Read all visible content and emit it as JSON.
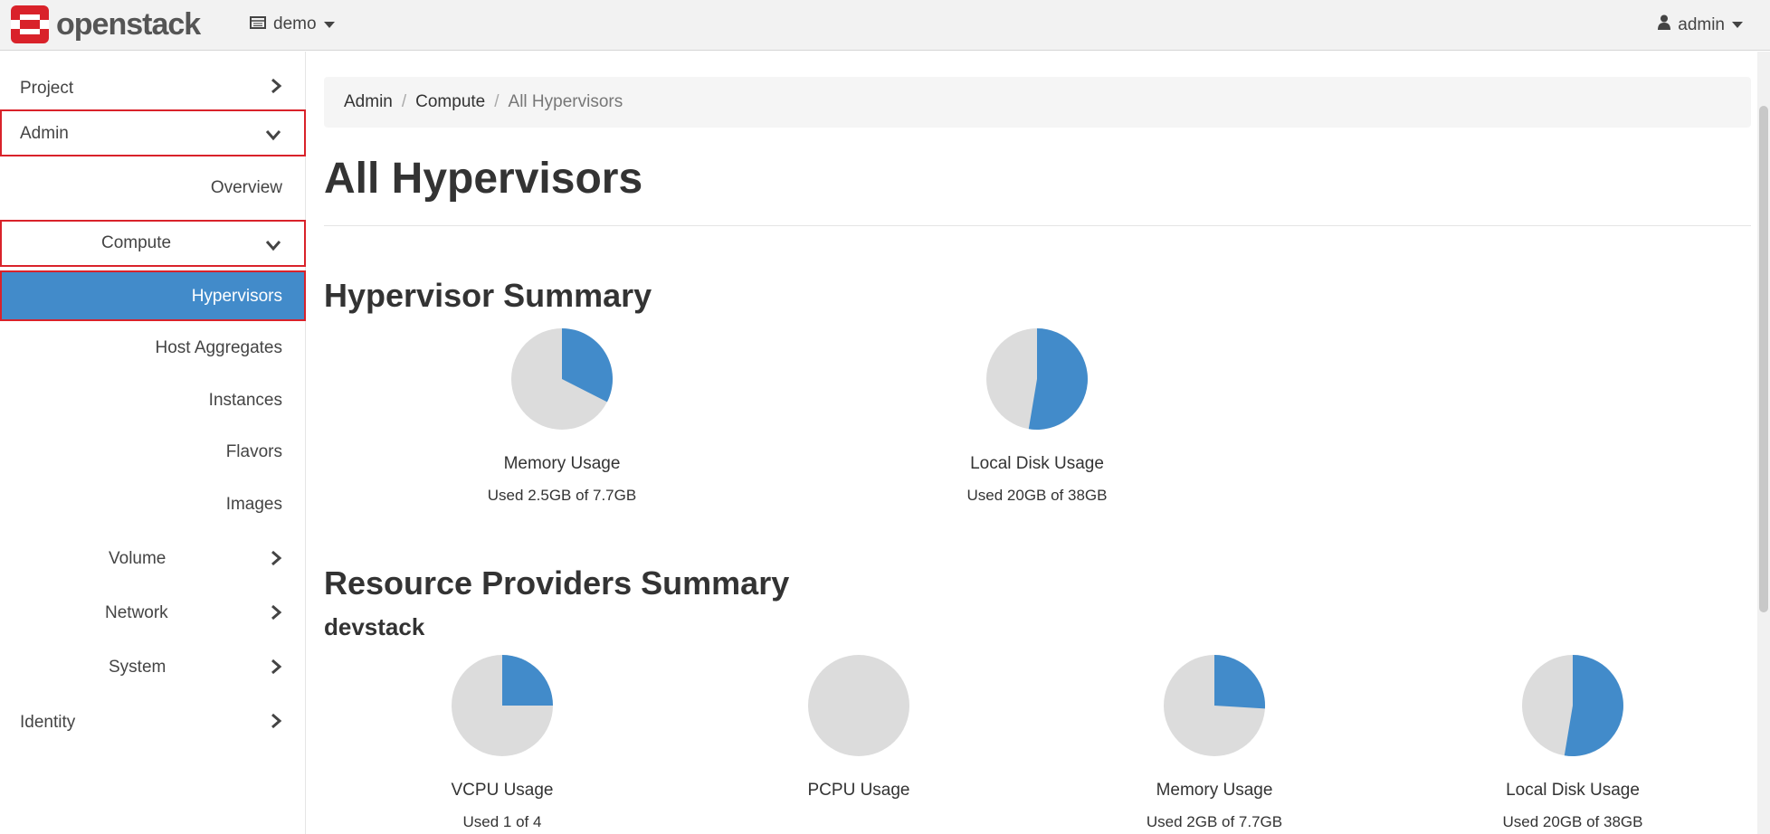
{
  "brand": {
    "name": "openstack",
    "accent": "#d9222a"
  },
  "topbar": {
    "project": "demo",
    "user": "admin"
  },
  "sidebar": {
    "project": "Project",
    "admin": "Admin",
    "overview": "Overview",
    "compute": "Compute",
    "hypervisors": "Hypervisors",
    "host_aggregates": "Host Aggregates",
    "instances": "Instances",
    "flavors": "Flavors",
    "images": "Images",
    "volume": "Volume",
    "network": "Network",
    "system": "System",
    "identity": "Identity"
  },
  "breadcrumb": {
    "admin": "Admin",
    "compute": "Compute",
    "current": "All Hypervisors",
    "sep": "/"
  },
  "page": {
    "title": "All Hypervisors",
    "hypervisor_summary": "Hypervisor Summary",
    "resource_summary": "Resource Providers Summary",
    "provider_name": "devstack"
  },
  "chart_data": [
    {
      "type": "pie",
      "title": "Memory Usage",
      "subtitle": "Used 2.5GB of 7.7GB",
      "used": 2.5,
      "total": 7.7
    },
    {
      "type": "pie",
      "title": "Local Disk Usage",
      "subtitle": "Used 20GB of 38GB",
      "used": 20,
      "total": 38
    },
    {
      "type": "pie",
      "title": "VCPU Usage",
      "subtitle": "Used 1 of 4",
      "used": 1,
      "total": 4
    },
    {
      "type": "pie",
      "title": "PCPU Usage",
      "subtitle": "",
      "used": 0,
      "total": 1
    },
    {
      "type": "pie",
      "title": "Memory Usage",
      "subtitle": "Used 2GB of 7.7GB",
      "used": 2,
      "total": 7.7
    },
    {
      "type": "pie",
      "title": "Local Disk Usage",
      "subtitle": "Used 20GB of 38GB",
      "used": 20,
      "total": 38
    }
  ],
  "colors": {
    "used": "#428bca",
    "free": "#dcdcdc",
    "active_nav": "#428bca",
    "highlight_border": "#d9222a"
  }
}
